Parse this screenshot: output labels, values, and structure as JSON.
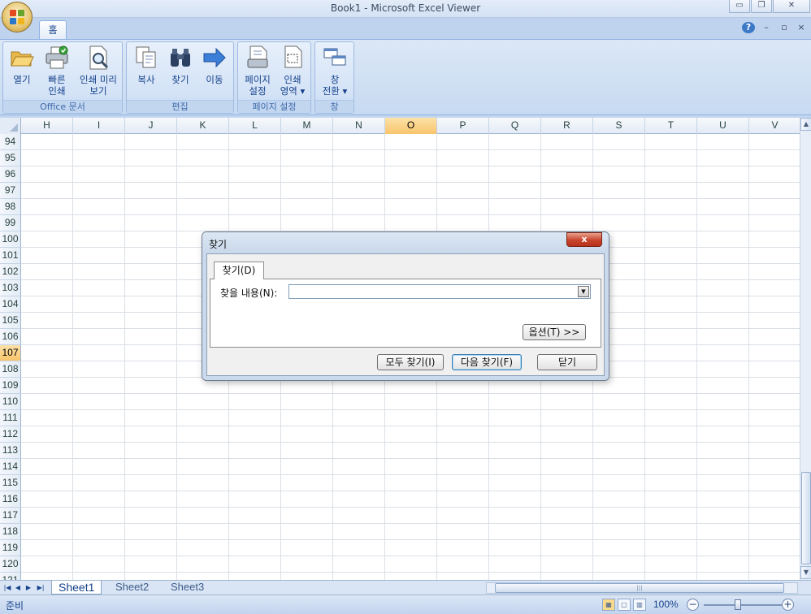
{
  "window": {
    "title": "Book1 - Microsoft Excel Viewer",
    "minimize": "▭",
    "restore": "❐",
    "close": "✕"
  },
  "ribbon": {
    "tab": "홈",
    "help": "?",
    "min": "–",
    "restore": "▫",
    "close": "×",
    "groups": {
      "office": {
        "label": "Office 문서",
        "buttons": [
          {
            "label1": "열기",
            "label2": ""
          },
          {
            "label1": "빠른",
            "label2": "인쇄"
          },
          {
            "label1": "인쇄 미리",
            "label2": "보기"
          }
        ]
      },
      "edit": {
        "label": "편집",
        "buttons": [
          {
            "label1": "복사",
            "label2": ""
          },
          {
            "label1": "찾기",
            "label2": ""
          },
          {
            "label1": "이동",
            "label2": ""
          }
        ]
      },
      "page": {
        "label": "페이지 설정",
        "buttons": [
          {
            "label1": "페이지",
            "label2": "설정"
          },
          {
            "label1": "인쇄",
            "label2": "영역 ▾"
          }
        ]
      },
      "window": {
        "label": "창",
        "buttons": [
          {
            "label1": "창",
            "label2": "전환 ▾"
          }
        ]
      }
    }
  },
  "sheet": {
    "columns": [
      "H",
      "I",
      "J",
      "K",
      "L",
      "M",
      "N",
      "O",
      "P",
      "Q",
      "R",
      "S",
      "T",
      "U",
      "V"
    ],
    "active_column": "O",
    "rows": [
      "94",
      "95",
      "96",
      "97",
      "98",
      "99",
      "100",
      "101",
      "102",
      "103",
      "104",
      "105",
      "106",
      "107",
      "108",
      "109",
      "110",
      "111",
      "112",
      "113",
      "114",
      "115",
      "116",
      "117",
      "118",
      "119",
      "120",
      "121"
    ],
    "active_row": "107"
  },
  "sheet_tabs": [
    "Sheet1",
    "Sheet2",
    "Sheet3"
  ],
  "sheet_nav": [
    "|◀",
    "◀",
    "▶",
    "▶|"
  ],
  "status": {
    "text": "준비",
    "zoom": "100%",
    "zoom_out": "−",
    "zoom_in": "+"
  },
  "dialog": {
    "title": "찾기",
    "close": "x",
    "tab": "찾기(D)",
    "find_label": "찾을 내용(N):",
    "find_value": "",
    "options_button": "옵션(T) >>",
    "find_all_button": "모두 찾기(I)",
    "find_next_button": "다음 찾기(F)",
    "close_button": "닫기"
  },
  "colors": {
    "ribbon_text": "#15428b",
    "active_header": "#f9c46b",
    "close_red": "#c8442c"
  }
}
